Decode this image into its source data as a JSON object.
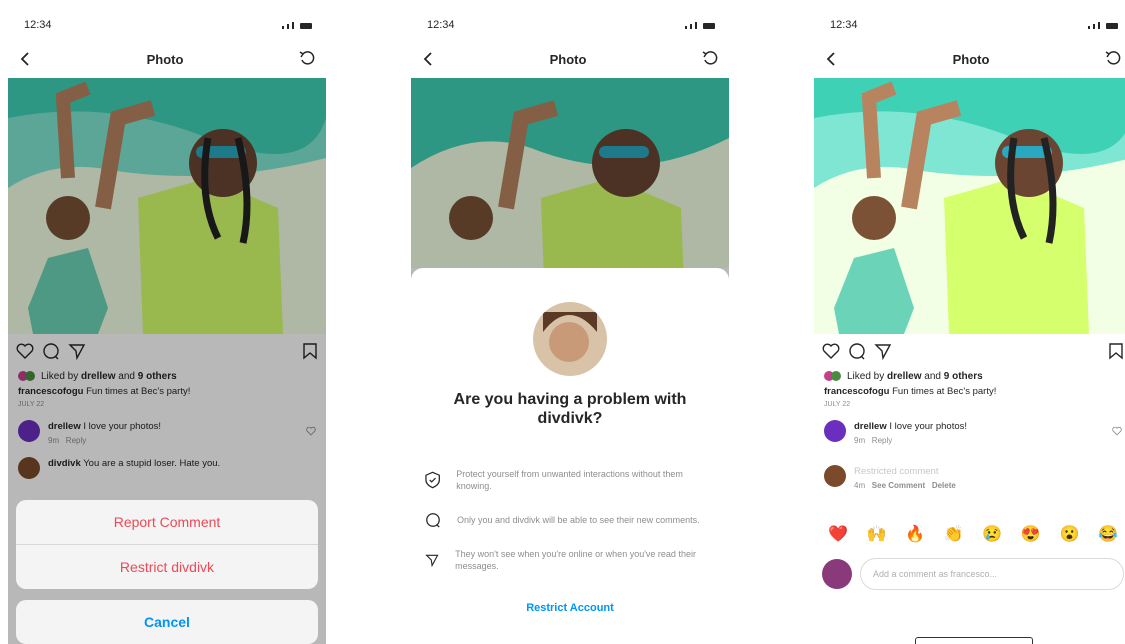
{
  "status": {
    "time": "12:34"
  },
  "nav": {
    "title": "Photo"
  },
  "post": {
    "liked_prefix": "Liked by",
    "liked_user": "drellew",
    "liked_and": "and",
    "liked_others": "9 others",
    "caption_user": "francescofogu",
    "caption_text": "Fun times at Bec's party!",
    "date": "JULY 22"
  },
  "comments": [
    {
      "user": "drellew",
      "text": "I love your photos!",
      "time": "9m",
      "reply": "Reply"
    },
    {
      "user": "divdivk",
      "text": "You are a stupid loser. Hate you."
    }
  ],
  "action_sheet": {
    "report": "Report Comment",
    "restrict": "Restrict divdivk",
    "cancel": "Cancel"
  },
  "restrict_modal": {
    "title": "Are you having a problem with divdivk?",
    "items": [
      {
        "icon": "shield-icon",
        "text": "Protect yourself from unwanted interactions without them knowing."
      },
      {
        "icon": "comment-icon",
        "text": "Only you and divdivk will be able to see their new comments."
      },
      {
        "icon": "send-icon",
        "text": "They won't see when you're online or when you've read their messages."
      }
    ],
    "action": "Restrict Account"
  },
  "restricted_comment": {
    "label": "Restricted comment",
    "time": "4m",
    "see": "See Comment",
    "delete": "Delete"
  },
  "emojis": [
    "❤️",
    "🙌",
    "🔥",
    "👏",
    "😢",
    "😍",
    "😮",
    "😂"
  ],
  "add_comment": {
    "placeholder": "Add a comment as francesco..."
  },
  "colors": {
    "accent_blue": "#0095f6",
    "alert_red": "#ed4956"
  }
}
